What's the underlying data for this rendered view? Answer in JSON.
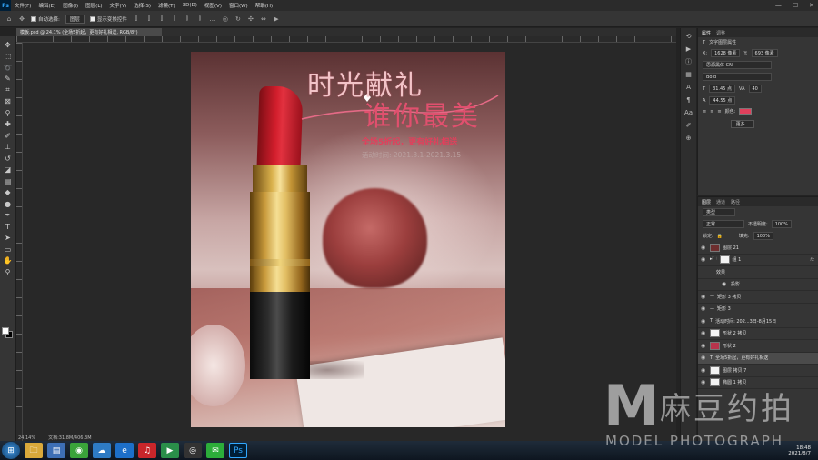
{
  "app": {
    "logo": "Ps"
  },
  "menubar": {
    "items": [
      "文件(F)",
      "编辑(E)",
      "图像(I)",
      "图层(L)",
      "文字(Y)",
      "选择(S)",
      "滤镜(T)",
      "3D(D)",
      "视图(V)",
      "窗口(W)",
      "帮助(H)"
    ],
    "window_controls": [
      "—",
      "☐",
      "✕"
    ]
  },
  "optionsbar": {
    "auto_select_label": "自动选择:",
    "auto_select_value": "图层",
    "show_transform_label": "显示变换控件"
  },
  "document": {
    "tab_title": "模板.psd @ 24.1% (全场5折起，更有好礼相送, RGB/8*)"
  },
  "artwork": {
    "title_line1": "时光献礼",
    "title_line2": "谁你最美",
    "subline": "全场5折起，更有好礼相送",
    "dateline": "活动时间: 2021.3.1-2021.3.15"
  },
  "statusbar": {
    "zoom": "24.14%",
    "doc_size": "文档:31.8M/406.3M"
  },
  "properties": {
    "tabs": [
      "属性",
      "调整"
    ],
    "header": "文字图层属性",
    "x_label": "X:",
    "x_value": "1628 像素",
    "y_label": "Y:",
    "y_value": "693 像素",
    "font_family": "思源黑体 CN",
    "font_style": "Bold",
    "font_size": "31.45 点",
    "tracking": "40",
    "leading": "44.55 点",
    "color_label": "颜色:",
    "color_value": "#e0405c",
    "more_button": "更多..."
  },
  "layers": {
    "tabs": [
      "图层",
      "通道",
      "路径"
    ],
    "filter_kind": "类型",
    "blend_mode": "正常",
    "opacity_label": "不透明度:",
    "opacity_value": "100%",
    "lock_label": "锁定:",
    "fill_label": "填充:",
    "fill_value": "100%",
    "rows": [
      {
        "name": "图层 21",
        "thumb": "dark"
      },
      {
        "name": "组 1",
        "thumb": "light"
      },
      {
        "name": "效果",
        "thumb": "none"
      },
      {
        "name": "投影",
        "thumb": "none"
      },
      {
        "name": "矩形 3 拷贝",
        "thumb": "none"
      },
      {
        "name": "矩形 3",
        "thumb": "none"
      },
      {
        "name": "活动时间: 202...3日-8月15日",
        "thumb": "text"
      },
      {
        "name": "形状 2 拷贝",
        "thumb": "light"
      },
      {
        "name": "形状 2",
        "thumb": "red"
      },
      {
        "name": "全场5折起，更有好礼相送",
        "thumb": "text"
      },
      {
        "name": "图层 拷贝 7",
        "thumb": "light"
      },
      {
        "name": "椭圆 1 拷贝",
        "thumb": "light"
      }
    ]
  },
  "taskbar": {
    "time": "18:48",
    "date": "2021/8/7",
    "apps": [
      "explorer",
      "notepad",
      "browser-360",
      "cloud",
      "ie",
      "netease-music",
      "player",
      "camera",
      "wechat",
      "photoshop"
    ]
  },
  "watermark": {
    "mark": "M",
    "cn": "麻豆约拍",
    "en": "MODEL PHOTOGRAPH"
  }
}
